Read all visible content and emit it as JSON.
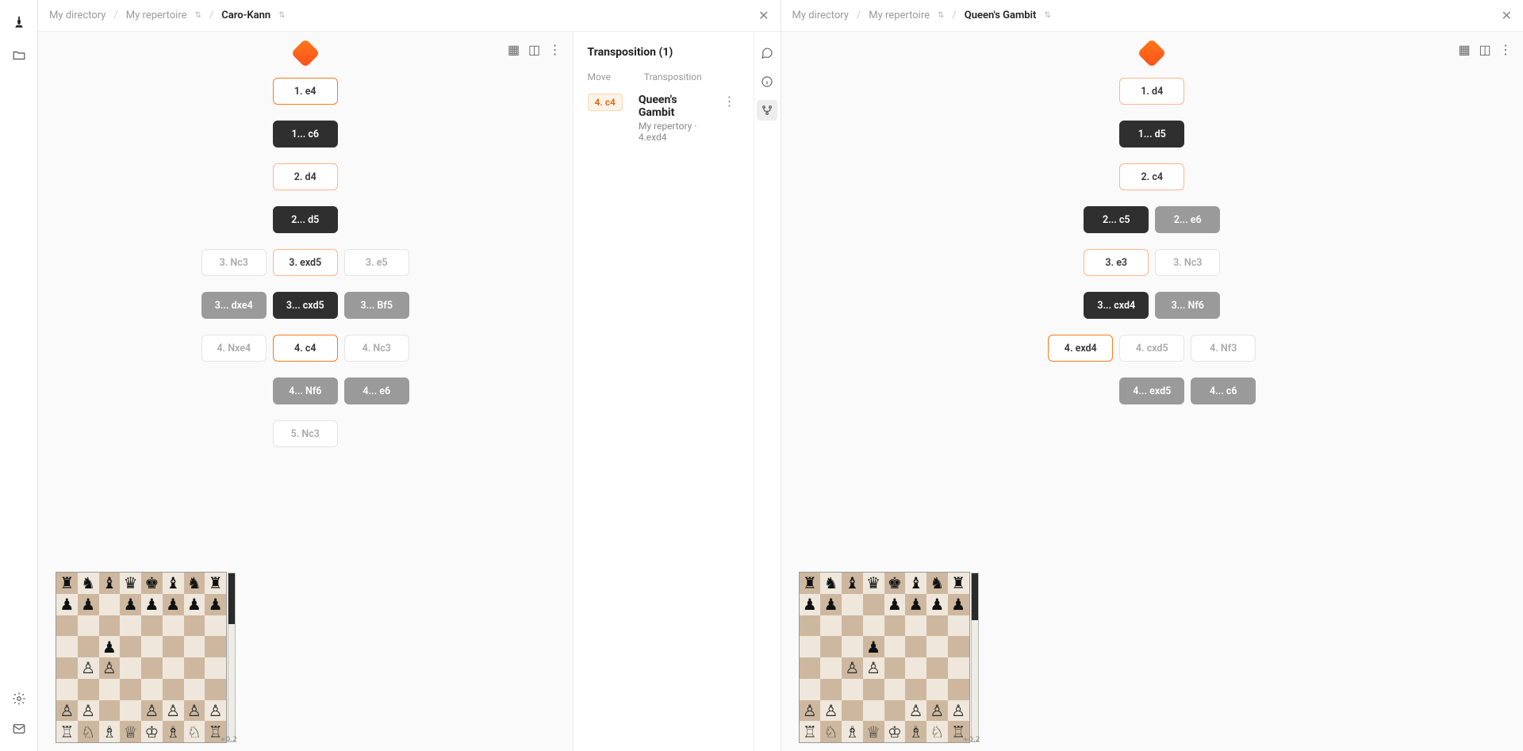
{
  "rail": {
    "logo_tip": "Home",
    "folder_tip": "Files",
    "settings_tip": "Settings",
    "mail_tip": "Feedback"
  },
  "left_pane": {
    "crumbs": [
      "My directory",
      "My repertoire",
      "Caro-Kann"
    ],
    "tree": {
      "root": "start",
      "rows": [
        [
          {
            "t": "1. e4",
            "k": "main selected-orange"
          }
        ],
        [
          {
            "t": "1... c6",
            "k": "dark"
          }
        ],
        [
          {
            "t": "2. d4",
            "k": "main"
          }
        ],
        [
          {
            "t": "2... d5",
            "k": "dark"
          }
        ],
        [
          {
            "t": "3. Nc3",
            "k": "faint"
          },
          {
            "t": "3. exd5",
            "k": "main"
          },
          {
            "t": "3. e5",
            "k": "faint"
          }
        ],
        [
          {
            "t": "3... dxe4",
            "k": "grey"
          },
          {
            "t": "3... cxd5",
            "k": "dark"
          },
          {
            "t": "3... Bf5",
            "k": "grey"
          }
        ],
        [
          {
            "t": "4. Nxe4",
            "k": "faint"
          },
          {
            "t": "4. c4",
            "k": "main selected-orange"
          },
          {
            "t": "4. Nc3",
            "k": "faint"
          }
        ],
        [
          {
            "t": "",
            "k": "none"
          },
          {
            "t": "4... Nf6",
            "k": "grey"
          },
          {
            "t": "4... e6",
            "k": "grey"
          }
        ],
        [
          {
            "t": "",
            "k": "none"
          },
          {
            "t": "5. Nc3",
            "k": "faint"
          },
          {
            "t": "",
            "k": "none"
          }
        ]
      ]
    },
    "side": {
      "title": "Transposition (1)",
      "move_label": "Move",
      "trans_label": "Transposition",
      "move_pill": "4. c4",
      "trans_title": "Queen's Gambit",
      "trans_sub": "My repertory  ·  4.exd4"
    },
    "board": {
      "pieces": {
        "a8": "♜",
        "b8": "♞",
        "c8": "♝",
        "d8": "♛",
        "e8": "♚",
        "f8": "♝",
        "g8": "♞",
        "h8": "♜",
        "a7": "♟",
        "b7": "♟",
        "d7": "♟",
        "e7": "♟",
        "f7": "♟",
        "g7": "♟",
        "h7": "♟",
        "c5": "♟",
        "b4": "♙",
        "c4": "♙",
        "a2": "♙",
        "b2": "♙",
        "e2": "♙",
        "f2": "♙",
        "g2": "♙",
        "h2": "♙",
        "a1": "♖",
        "b1": "♘",
        "c1": "♗",
        "d1": "♕",
        "e1": "♔",
        "f1": "♗",
        "g1": "♘",
        "h1": "♖"
      },
      "eval_black_pct": 30,
      "eval_text": "+0.2"
    }
  },
  "right_pane": {
    "crumbs": [
      "My directory",
      "My repertoire",
      "Queen's Gambit"
    ],
    "tree": {
      "rows": [
        [
          {
            "t": "1. d4",
            "k": "main"
          }
        ],
        [
          {
            "t": "1... d5",
            "k": "dark"
          }
        ],
        [
          {
            "t": "2. c4",
            "k": "main"
          }
        ],
        [
          {
            "t": "2... c5",
            "k": "dark"
          },
          {
            "t": "2... e6",
            "k": "grey"
          }
        ],
        [
          {
            "t": "3. e3",
            "k": "main"
          },
          {
            "t": "3. Nc3",
            "k": "faint"
          }
        ],
        [
          {
            "t": "3... cxd4",
            "k": "dark"
          },
          {
            "t": "3... Nf6",
            "k": "grey"
          }
        ],
        [
          {
            "t": "4. exd4",
            "k": "main selected-orange"
          },
          {
            "t": "4. cxd5",
            "k": "faint"
          },
          {
            "t": "4. Nf3",
            "k": "faint"
          }
        ],
        [
          {
            "t": "",
            "k": "none"
          },
          {
            "t": "4... exd5",
            "k": "grey"
          },
          {
            "t": "4... c6",
            "k": "grey"
          }
        ]
      ]
    },
    "board": {
      "pieces": {
        "a8": "♜",
        "b8": "♞",
        "c8": "♝",
        "d8": "♛",
        "e8": "♚",
        "f8": "♝",
        "g8": "♞",
        "h8": "♜",
        "a7": "♟",
        "b7": "♟",
        "e7": "♟",
        "f7": "♟",
        "g7": "♟",
        "h7": "♟",
        "d5": "♟",
        "c4": "♙",
        "d4": "♙",
        "a2": "♙",
        "b2": "♙",
        "f2": "♙",
        "g2": "♙",
        "h2": "♙",
        "a1": "♖",
        "b1": "♘",
        "c1": "♗",
        "d1": "♕",
        "e1": "♔",
        "f1": "♗",
        "g1": "♘",
        "h1": "♖"
      },
      "eval_black_pct": 28,
      "eval_text": "+0.2"
    }
  }
}
